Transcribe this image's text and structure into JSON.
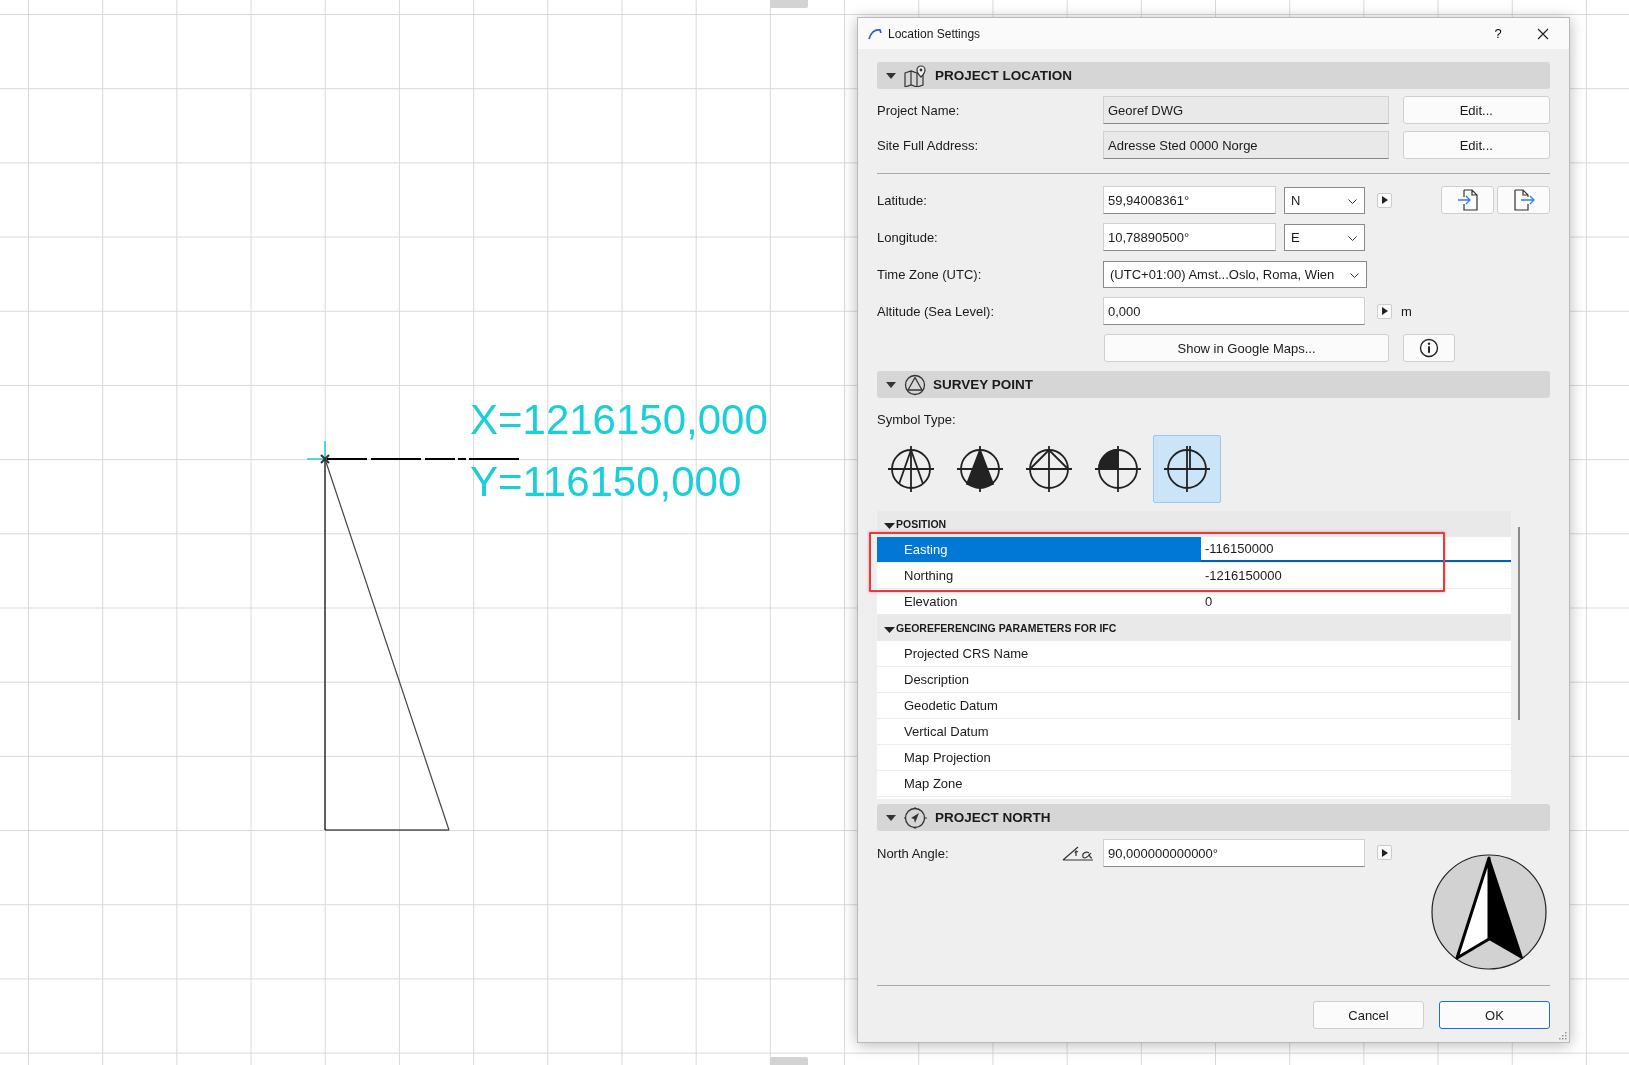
{
  "canvas": {
    "coordinate_labels": [
      "X=1216150,000",
      "Y=116150,000"
    ]
  },
  "dialog": {
    "title": "Location Settings",
    "help_button": "?"
  },
  "project_location": {
    "title": "PROJECT LOCATION",
    "info_rows": [
      {
        "label": "Project Name:",
        "value": "Georef DWG",
        "button": "Edit..."
      },
      {
        "label": "Site Full Address:",
        "value": "Adresse Sted 0000 Norge",
        "button": "Edit..."
      }
    ],
    "latitude": {
      "label": "Latitude:",
      "value": "59,94008361°",
      "hemisphere": "N"
    },
    "longitude": {
      "label": "Longitude:",
      "value": "10,78890500°",
      "hemisphere": "E"
    },
    "time_zone": {
      "label": "Time Zone (UTC):",
      "value": "(UTC+01:00) Amst...Oslo, Roma, Wien"
    },
    "altitude": {
      "label": "Altitude (Sea Level):",
      "value": "0,000",
      "unit": "m"
    },
    "maps_button": "Show in Google Maps..."
  },
  "survey_point": {
    "title": "SURVEY POINT",
    "symbol_label": "Symbol Type:",
    "symbols": [
      {
        "kind": "triangle",
        "selected": false
      },
      {
        "kind": "filled-triangle",
        "selected": false
      },
      {
        "kind": "roof",
        "selected": false
      },
      {
        "kind": "quarter",
        "selected": false
      },
      {
        "kind": "double-line",
        "selected": true
      }
    ],
    "property_groups": [
      {
        "title": "POSITION",
        "rows": [
          {
            "name": "Easting",
            "value": "-116150000",
            "selected": true,
            "highlighted": true
          },
          {
            "name": "Northing",
            "value": "-1216150000",
            "selected": false,
            "highlighted": true
          },
          {
            "name": "Elevation",
            "value": "0",
            "selected": false,
            "highlighted": false
          }
        ]
      },
      {
        "title": "GEOREFERENCING PARAMETERS FOR IFC",
        "rows": [
          {
            "name": "Projected CRS Name",
            "selected": false,
            "highlighted": false
          },
          {
            "name": "Description",
            "selected": false,
            "highlighted": false
          },
          {
            "name": "Geodetic Datum",
            "selected": false,
            "highlighted": false
          },
          {
            "name": "Vertical Datum",
            "selected": false,
            "highlighted": false
          },
          {
            "name": "Map Projection",
            "selected": false,
            "highlighted": false
          },
          {
            "name": "Map Zone",
            "selected": false,
            "highlighted": false
          }
        ]
      }
    ]
  },
  "project_north": {
    "title": "PROJECT NORTH",
    "label": "North Angle:",
    "value": "90,000000000000°"
  },
  "buttons": [
    {
      "label": "Cancel",
      "default": false
    },
    {
      "label": "OK",
      "default": true
    }
  ]
}
